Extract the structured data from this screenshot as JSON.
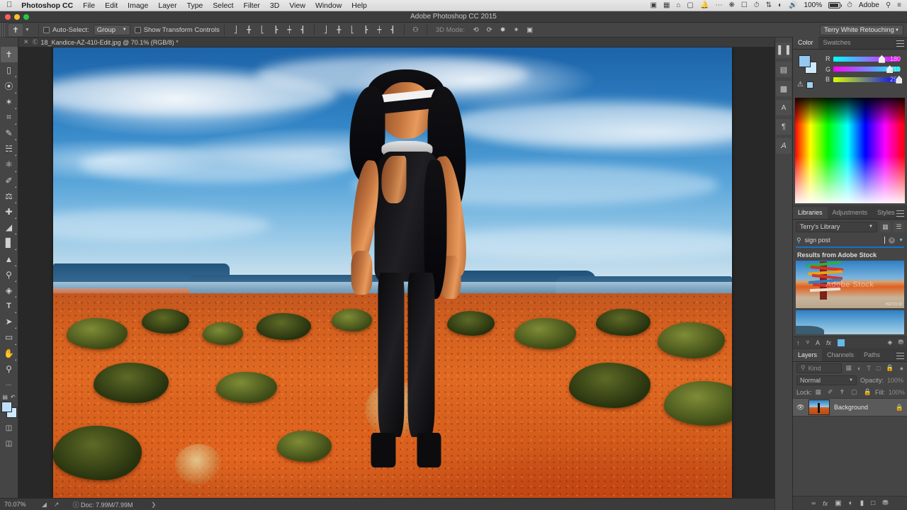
{
  "macos_menu": {
    "apple_icon": "apple-icon",
    "items": [
      {
        "label": "Photoshop CC",
        "bold": true
      },
      {
        "label": "File"
      },
      {
        "label": "Edit"
      },
      {
        "label": "Image"
      },
      {
        "label": "Layer"
      },
      {
        "label": "Type"
      },
      {
        "label": "Select"
      },
      {
        "label": "Filter"
      },
      {
        "label": "3D"
      },
      {
        "label": "View"
      },
      {
        "label": "Window"
      },
      {
        "label": "Help"
      }
    ],
    "tray": {
      "icons": [
        "screen-share-icon",
        "display-icon",
        "home-icon",
        "screen-record-icon",
        "bell-icon",
        "ellipsis-icon",
        "dropbox-icon",
        "airplay-icon",
        "time-machine-icon",
        "bluetooth-icon",
        "wifi-icon",
        "volume-icon"
      ],
      "battery_percent": "100%",
      "battery_icon": "battery-icon",
      "clock_icon": "clock-icon",
      "account_label": "Adobe",
      "search_icon": "search-icon",
      "notification_icon": "notification-center-icon"
    }
  },
  "window": {
    "title": "Adobe Photoshop CC 2015",
    "traffic_lights": [
      "close-button",
      "minimize-button",
      "zoom-button"
    ],
    "colors": {
      "close": "#ff5f57",
      "minimize": "#ffbd2e",
      "zoom": "#28c940"
    }
  },
  "options_bar": {
    "active_tool_icon": "move-tool-icon",
    "tool_preset_chevron": "chevron-down-icon",
    "auto_select_label": "Auto-Select:",
    "auto_select_checked": false,
    "auto_select_value": "Group",
    "show_transform_label": "Show Transform Controls",
    "show_transform_checked": false,
    "align_buttons": [
      "align-top-edges",
      "align-vertical-centers",
      "align-bottom-edges",
      "align-left-edges",
      "align-horizontal-centers",
      "align-right-edges"
    ],
    "distribute_buttons": [
      "distribute-top-edges",
      "distribute-vertical-centers",
      "distribute-bottom-edges",
      "distribute-left-edges",
      "distribute-horizontal-centers",
      "distribute-right-edges"
    ],
    "extra_button": "align-options-icon",
    "mode_3d_label": "3D Mode:",
    "mode_3d_buttons": [
      "rotate-3d-icon",
      "roll-3d-icon",
      "drag-3d-icon",
      "slide-3d-icon",
      "scale-3d-icon"
    ],
    "workspace": "Terry White Retouching",
    "workspace_chevron": "chevron-down-icon"
  },
  "tools_panel": {
    "tools": [
      {
        "name": "move-tool",
        "glyph": "✥",
        "selected": true,
        "corner": false
      },
      {
        "name": "rectangular-marquee-tool",
        "glyph": "▭",
        "selected": false,
        "corner": true
      },
      {
        "name": "lasso-tool",
        "glyph": "◯",
        "selected": false,
        "corner": true
      },
      {
        "name": "magic-wand-tool",
        "glyph": "✦",
        "selected": false,
        "corner": true
      },
      {
        "name": "crop-tool",
        "glyph": "⌗",
        "selected": false,
        "corner": true
      },
      {
        "name": "eyedropper-tool",
        "glyph": "✎",
        "selected": false,
        "corner": true
      },
      {
        "name": "spot-healing-brush-tool",
        "glyph": "◍",
        "selected": false,
        "corner": true
      },
      {
        "name": "brush-tool",
        "glyph": "✐",
        "selected": false,
        "corner": true
      },
      {
        "name": "clone-stamp-tool",
        "glyph": "⎈",
        "selected": false,
        "corner": true
      },
      {
        "name": "history-brush-tool",
        "glyph": "❧",
        "selected": false,
        "corner": true
      },
      {
        "name": "eraser-tool",
        "glyph": "◣",
        "selected": false,
        "corner": true
      },
      {
        "name": "gradient-tool",
        "glyph": "▦",
        "selected": false,
        "corner": true
      },
      {
        "name": "blur-tool",
        "glyph": "◭",
        "selected": false,
        "corner": true
      },
      {
        "name": "dodge-tool",
        "glyph": "◉",
        "selected": false,
        "corner": true
      },
      {
        "name": "pen-tool",
        "glyph": "✒",
        "selected": false,
        "corner": true
      },
      {
        "name": "horizontal-type-tool",
        "glyph": "T",
        "selected": false,
        "corner": true
      },
      {
        "name": "path-selection-tool",
        "glyph": "➤",
        "selected": false,
        "corner": true
      },
      {
        "name": "rectangle-tool",
        "glyph": "▭",
        "selected": false,
        "corner": true
      },
      {
        "name": "hand-tool",
        "glyph": "✋",
        "selected": false,
        "corner": true
      },
      {
        "name": "zoom-tool",
        "glyph": "⌕",
        "selected": false,
        "corner": false
      },
      {
        "name": "edit-toolbar-button",
        "glyph": "•••",
        "selected": false,
        "corner": false
      }
    ],
    "default_colors_icon": "default-colors-icon",
    "swap_colors_icon": "swap-colors-icon",
    "foreground_color": "#bfe0fb",
    "background_color": "#cfe9fe",
    "quick_mask_icon": "quick-mask-mode-icon",
    "screen_mode_icon": "screen-mode-icon"
  },
  "document": {
    "tab_close_icon": "close-icon",
    "tab_title": "18_Kandice-AZ-410-Edit.jpg @ 70.1% (RGB/8) *",
    "tab_prefix_icon": "cloud-doc-icon"
  },
  "status_bar": {
    "zoom_level": "70.07%",
    "icons": [
      "resize-grip-icon",
      "share-icon"
    ],
    "doc_info": "Doc: 7.99M/7.99M",
    "doc_icon": "info-icon",
    "expand_icon": "chevron-right-icon"
  },
  "dock_rail": {
    "icons": [
      {
        "name": "histogram-panel-icon",
        "glyph": "▯▮"
      },
      {
        "name": "properties-panel-icon",
        "glyph": "▤"
      },
      {
        "name": "layer-comps-panel-icon",
        "glyph": "▨"
      },
      {
        "name": "character-panel-icon",
        "glyph": "A"
      },
      {
        "name": "paragraph-panel-icon",
        "glyph": "¶"
      },
      {
        "name": "character-styles-panel-icon",
        "glyph": "𝐴"
      }
    ]
  },
  "color_panel": {
    "tabs": [
      {
        "label": "Color",
        "active": true
      },
      {
        "label": "Swatches",
        "active": false
      }
    ],
    "menu_icon": "panel-menu-icon",
    "foreground_swatch": "#93c9f0",
    "background_swatch": "#cfe9fe",
    "gamut_warning_icon": "out-of-gamut-warning-icon",
    "web_safe_swatch": "#9fd3f5",
    "channels": [
      {
        "label": "R",
        "value": "180",
        "pos": 70
      },
      {
        "label": "G",
        "value": "210",
        "pos": 82
      },
      {
        "label": "B",
        "value": "255",
        "pos": 97
      }
    ]
  },
  "libraries_panel": {
    "tabs": [
      {
        "label": "Libraries",
        "active": true
      },
      {
        "label": "Adjustments",
        "active": false
      },
      {
        "label": "Styles",
        "active": false
      }
    ],
    "menu_icon": "panel-menu-icon",
    "library_name": "Terry's Library",
    "library_chevron": "chevron-down-icon",
    "view_grid_icon": "grid-view-icon",
    "view_list_icon": "list-view-icon",
    "search_icon": "search-icon",
    "search_value": "sign post",
    "search_clear_icon": "clear-icon",
    "search_chevron_icon": "chevron-down-icon",
    "results_label": "Results from Adobe Stock",
    "results": [
      {
        "name": "signpost-stock-thumbnail",
        "watermark": "Adobe Stock",
        "id": "#92723 33"
      },
      {
        "name": "sky-stock-thumbnail",
        "watermark": "",
        "id": ""
      }
    ],
    "footer_icons": [
      "upload-icon",
      "add-graphic-icon",
      "add-text-style-icon",
      "add-layer-style-icon",
      "add-color-icon",
      "view-on-web-icon",
      "delete-icon"
    ],
    "footer_color_swatch": "#66b8e8"
  },
  "layers_panel": {
    "tabs": [
      {
        "label": "Layers",
        "active": true
      },
      {
        "label": "Channels",
        "active": false
      },
      {
        "label": "Paths",
        "active": false
      }
    ],
    "menu_icon": "panel-menu-icon",
    "filter_search_icon": "search-icon",
    "filter_label": "Kind",
    "filter_icons": [
      "filter-pixel-icon",
      "filter-adjustment-icon",
      "filter-type-icon",
      "filter-shape-icon",
      "filter-smart-object-icon"
    ],
    "filter_toggle_icon": "filter-toggle-icon",
    "blend_mode": "Normal",
    "blend_chevron": "chevron-down-icon",
    "opacity_label": "Opacity:",
    "opacity_value": "100%",
    "lock_label": "Lock:",
    "lock_icons": [
      "lock-transparent-pixels-icon",
      "lock-image-pixels-icon",
      "lock-position-icon",
      "lock-artboard-icon",
      "lock-all-icon"
    ],
    "fill_label": "Fill:",
    "fill_value": "100%",
    "layers": [
      {
        "name": "Background",
        "visible": true,
        "locked": true,
        "visibility_icon": "eye-icon",
        "lock_icon": "lock-icon"
      }
    ],
    "footer_icons": [
      {
        "name": "link-layers-icon",
        "glyph": "GD"
      },
      {
        "name": "layer-style-icon",
        "glyph": "fx"
      },
      {
        "name": "layer-mask-icon",
        "glyph": "▣"
      },
      {
        "name": "adjustment-layer-icon",
        "glyph": "◐"
      },
      {
        "name": "new-group-icon",
        "glyph": "▰"
      },
      {
        "name": "new-layer-icon",
        "glyph": "▢"
      },
      {
        "name": "delete-layer-icon",
        "glyph": "🗑"
      }
    ]
  },
  "canvas": {
    "image_description": "Desert landscape with fashion model",
    "zoom": "70.07%"
  }
}
